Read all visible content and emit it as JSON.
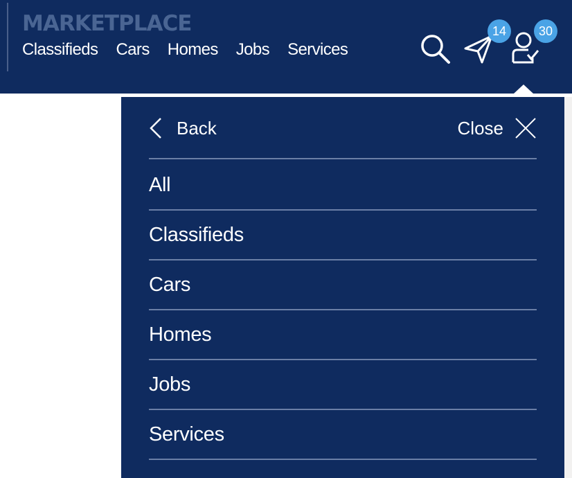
{
  "header": {
    "brand": "MARKETPLACE",
    "nav": [
      {
        "label": "Classifieds"
      },
      {
        "label": "Cars"
      },
      {
        "label": "Homes"
      },
      {
        "label": "Jobs"
      },
      {
        "label": "Services"
      }
    ],
    "icons": {
      "search": "search-icon",
      "messages": "send-icon",
      "account": "user-check-icon"
    },
    "messages_badge": "14",
    "account_badge": "30"
  },
  "menu_panel": {
    "back_label": "Back",
    "close_label": "Close",
    "items": [
      {
        "label": "All"
      },
      {
        "label": "Classifieds"
      },
      {
        "label": "Cars"
      },
      {
        "label": "Homes"
      },
      {
        "label": "Jobs"
      },
      {
        "label": "Services"
      }
    ]
  },
  "colors": {
    "primary": "#0f2b5f",
    "brand_text": "#4a6593",
    "badge": "#4aa3e6",
    "divider": "#6b7fa6"
  }
}
